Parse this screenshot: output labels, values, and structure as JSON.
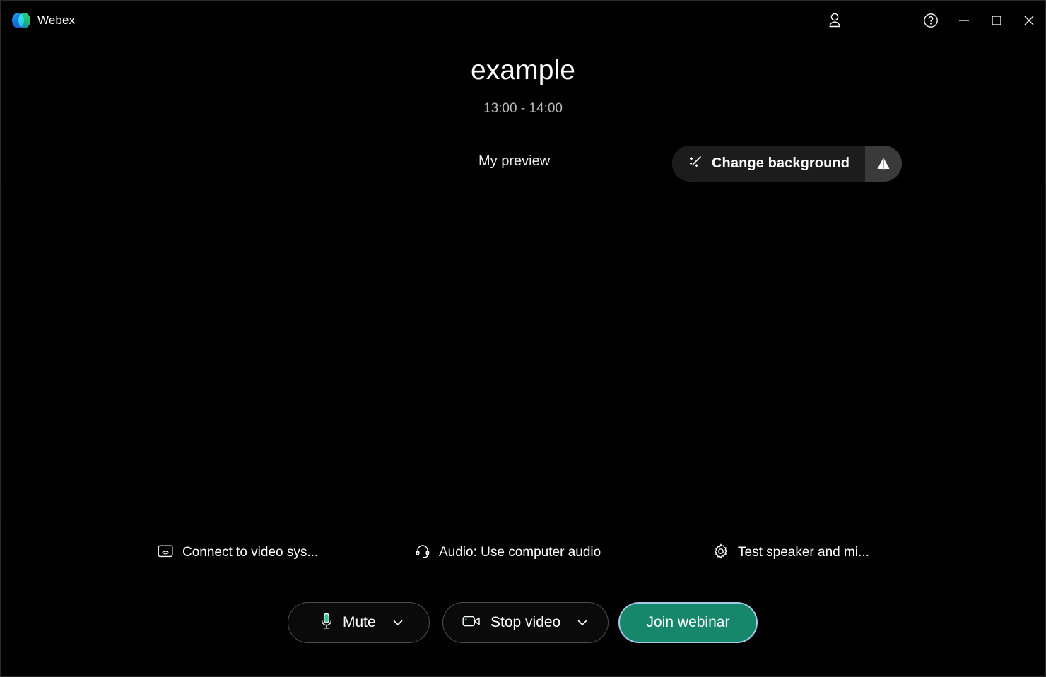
{
  "app": {
    "name": "Webex",
    "logo_icon": "webex-logo-icon",
    "accent_green": "#17876b",
    "focus_ring": "#a8c8e8",
    "background": "#000000"
  },
  "titlebar": {
    "account_icon": "person-icon",
    "account_label": "Account",
    "help_icon": "help-circle-icon",
    "help_label": "Help",
    "minimize_icon": "minimize-icon",
    "minimize_label": "Minimize",
    "maximize_icon": "maximize-icon",
    "maximize_label": "Maximize",
    "close_icon": "close-icon",
    "close_label": "Close"
  },
  "meeting": {
    "title": "example",
    "time_range": "13:00 - 14:00"
  },
  "preview": {
    "label": "My preview",
    "change_background_label": "Change background",
    "change_background_icon": "magic-wand-icon",
    "flip_icon": "mirror-flip-icon",
    "flip_label": "Mirror my video"
  },
  "device_options": [
    {
      "id": "connect-to-video-system",
      "label": "Connect to video sys...",
      "icon": "cast-screen-icon"
    },
    {
      "id": "audio-setting",
      "label": "Audio: Use computer audio",
      "icon": "headset-icon"
    },
    {
      "id": "test-speaker-and-microphone",
      "label": "Test speaker and mi...",
      "icon": "gear-icon"
    }
  ],
  "actions": {
    "mute": {
      "label": "Mute",
      "icon": "microphone-icon",
      "caret_icon": "chevron-down-icon"
    },
    "video": {
      "label": "Stop video",
      "icon": "camera-icon",
      "caret_icon": "chevron-down-icon"
    },
    "join": {
      "label": "Join webinar"
    }
  }
}
